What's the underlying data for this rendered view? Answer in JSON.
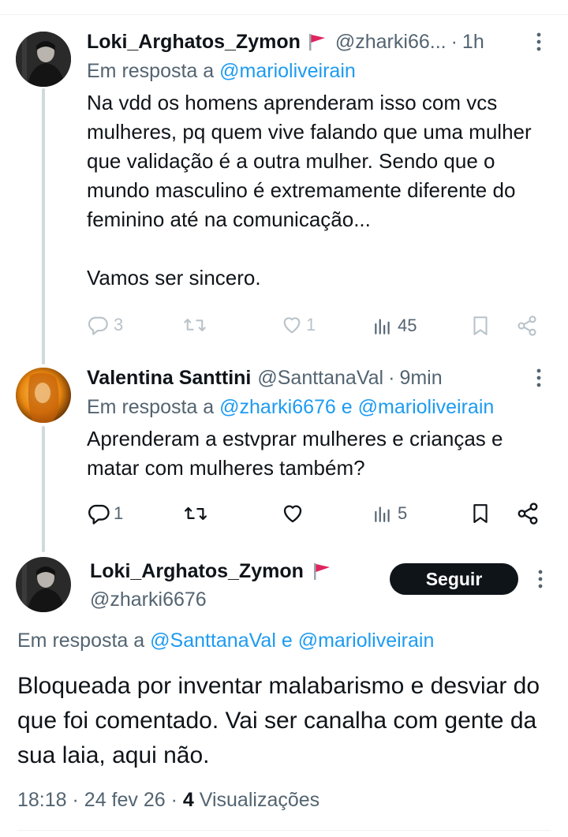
{
  "tweets": [
    {
      "author_name": "Loki_Arghatos_Zymon",
      "author_handle": "@zharki66...",
      "sep": "·",
      "time": "1h",
      "reply_prefix": "Em resposta a",
      "reply_to": "@marioliveirain",
      "text": "Na vdd os homens aprenderam isso com vcs mulheres, pq quem vive falando que uma mulher que validação é a outra mulher. Sendo que o mundo masculino é extremamente diferente do feminino até na comunicação...\n\nVamos ser sincero.",
      "replies": "3",
      "retweets": "",
      "likes": "1",
      "views": "45"
    },
    {
      "author_name": "Valentina Santtini",
      "author_handle": "@SanttanaVal",
      "sep": "·",
      "time": "9min",
      "reply_prefix": "Em resposta a",
      "reply_to_1": "@zharki6676",
      "reply_and": "e",
      "reply_to_2": "@marioliveirain",
      "text": "Aprenderam a estvprar mulheres e crianças e matar com mulheres também?",
      "replies": "1",
      "retweets": "",
      "likes": "",
      "views": "5"
    }
  ],
  "main_tweet": {
    "author_name": "Loki_Arghatos_Zymon",
    "author_handle": "@zharki6676",
    "follow_label": "Seguir",
    "reply_prefix": "Em resposta a",
    "reply_to_1": "@SanttanaVal",
    "reply_and": "e",
    "reply_to_2": "@marioliveirain",
    "text": "Bloqueada por inventar malabarismo e desviar do que foi comentado. Vai ser canalha com gente da sua laia, aqui não.",
    "time": "18:18",
    "sep": "·",
    "date": "24 fev 26",
    "views_count": "4",
    "views_label": "Visualizações"
  },
  "colors": {
    "accent": "#1d9bf0",
    "muted": "#536471",
    "text": "#0f1419",
    "flag": "#e0245e"
  }
}
